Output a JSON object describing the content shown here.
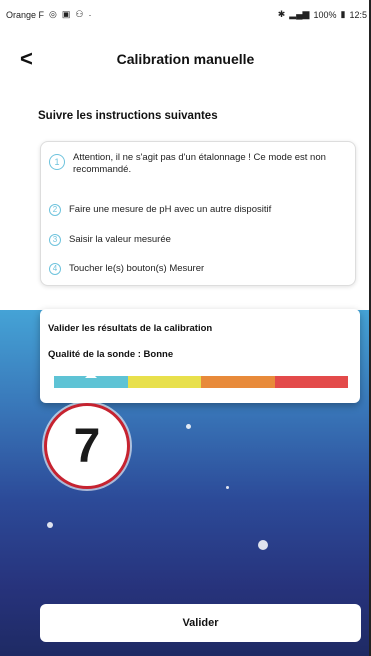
{
  "status_bar": {
    "carrier": "Orange F",
    "left_icons": [
      "notification-icon",
      "image-icon",
      "people-icon"
    ],
    "right_text": "100%",
    "time": "12:5"
  },
  "header": {
    "back_glyph": "<",
    "title": "Calibration manuelle"
  },
  "instructions": {
    "title": "Suivre les instructions suivantes",
    "steps": [
      {
        "number": "1",
        "text": "Attention, il ne s'agit pas d'un étalonnage ! Ce mode est non recommandé."
      },
      {
        "number": "2",
        "text": "Faire une mesure de pH avec un autre dispositif"
      },
      {
        "number": "3",
        "text": "Saisir la valeur mesurée"
      },
      {
        "number": "4",
        "text": "Toucher le(s) bouton(s) Mesurer"
      }
    ]
  },
  "results": {
    "title": "Valider les résultats de la calibration",
    "quality": "Qualité de la sonde : Bonne",
    "quality_level_index": 1,
    "scale_colors": [
      "#5ec3d5",
      "#e8e04c",
      "#e88a3a",
      "#e34a4a"
    ]
  },
  "annotation": {
    "number": "7",
    "border_color": "#c62330"
  },
  "footer": {
    "validate_label": "Valider"
  }
}
